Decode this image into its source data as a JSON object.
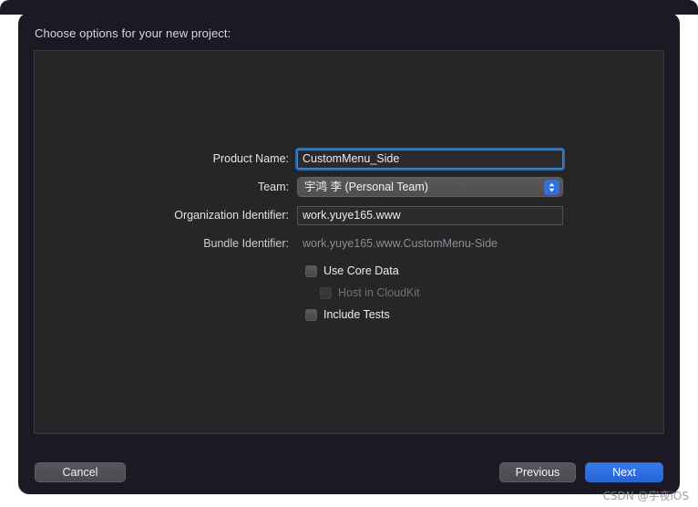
{
  "sheet": {
    "title": "Choose options for your new project:"
  },
  "form": {
    "fields": [
      {
        "label": "Product Name:",
        "type": "text",
        "value": "CustomMenu_Side",
        "placeholder": "",
        "focused": true
      },
      {
        "label": "Team:",
        "type": "popup",
        "value": "宇鸿 李 (Personal Team)",
        "options": [
          "宇鸿 李 (Personal Team)"
        ]
      },
      {
        "label": "Organization Identifier:",
        "type": "text",
        "value": "work.yuye165.www",
        "placeholder": "",
        "focused": false
      },
      {
        "label": "Bundle Identifier:",
        "type": "readonly",
        "value": "work.yuye165.www.CustomMenu-Side"
      }
    ],
    "checkboxes": [
      {
        "label": "Use Core Data",
        "checked": false,
        "disabled": false,
        "indented": false
      },
      {
        "label": "Host in CloudKit",
        "checked": false,
        "disabled": true,
        "indented": true
      },
      {
        "label": "Include Tests",
        "checked": false,
        "disabled": false,
        "indented": false
      }
    ]
  },
  "footer": {
    "cancel_label": "Cancel",
    "previous_label": "Previous",
    "next_label": "Next"
  },
  "watermark": {
    "text": "CSDN @宇夜iOS"
  },
  "colors": {
    "window_background": "#1c1924",
    "panel_background": "#262628",
    "accent_blue": "#2f6fe0",
    "focus_ring": "#2e6daa",
    "text_primary": "#ededf0",
    "text_dim": "#8e8c91"
  }
}
